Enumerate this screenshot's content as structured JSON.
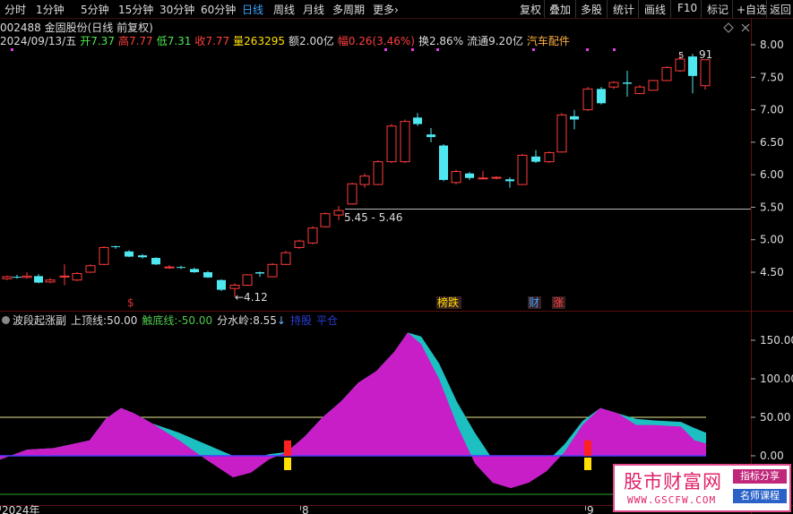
{
  "toolbar": {
    "periods": [
      "分时",
      "1分钟",
      "5分钟",
      "15分钟",
      "30分钟",
      "60分钟",
      "日线",
      "周线",
      "月线",
      "多周期",
      "更多"
    ],
    "active_period": "日线",
    "more_arrow": "›",
    "buttons": [
      "复权",
      "叠加",
      "多股",
      "统计",
      "画线",
      "F10",
      "标记",
      "+自选",
      "返回"
    ]
  },
  "stock": {
    "code_name": "002488 金固股份(日线 前复权)",
    "date": "2024/09/13/五",
    "open_label": "开",
    "open": "7.37",
    "high_label": "高",
    "high": "7.77",
    "low_label": "低",
    "low": "7.31",
    "close_label": "收",
    "close": "7.77",
    "vol_label": "量",
    "vol": "263295",
    "amount_label": "额",
    "amount": "2.00亿",
    "change_label": "幅",
    "change": "0.26(3.46%)",
    "turnover_label": "换",
    "turnover": "2.86%",
    "float_label": "流通",
    "float": "9.20亿",
    "sector": "汽车配件"
  },
  "price_axis": [
    "8.00",
    "7.50",
    "7.00",
    "6.50",
    "6.00",
    "5.50",
    "5.00",
    "4.50"
  ],
  "price_annotations": {
    "low_mark": "4.12",
    "range_mark": "5.45 - 5.46",
    "high_mark": "91"
  },
  "event_markers": [
    {
      "text": "$",
      "color": "#e03030"
    },
    {
      "text": "榜跌",
      "color": "#ffe000"
    },
    {
      "text": "财",
      "color": "#40a0ff"
    },
    {
      "text": "涨",
      "color": "#ff4040"
    }
  ],
  "indicator": {
    "name": "波段起涨副",
    "upper_label": "上顶线:",
    "upper": "50.00",
    "lower_label": "触底线:",
    "lower": "-50.00",
    "divide_label": "分水岭:",
    "divide": "8.55",
    "arrow": "↓",
    "extra1": "持股",
    "extra2": "平仓"
  },
  "ind_axis": [
    "150.00",
    "100.00",
    "50.00",
    "0.00"
  ],
  "time_axis": [
    "2024年",
    "8",
    "9"
  ],
  "logo": {
    "title": "股市财富网",
    "url": "WWW.GSCFW.COM",
    "tag1": "指标分享",
    "tag2": "名师课程"
  },
  "colors": {
    "up": "#ff3c3c",
    "down": "#4ee8f0",
    "magenta": "#c81ec8",
    "cyan": "#1cc0c0"
  }
}
